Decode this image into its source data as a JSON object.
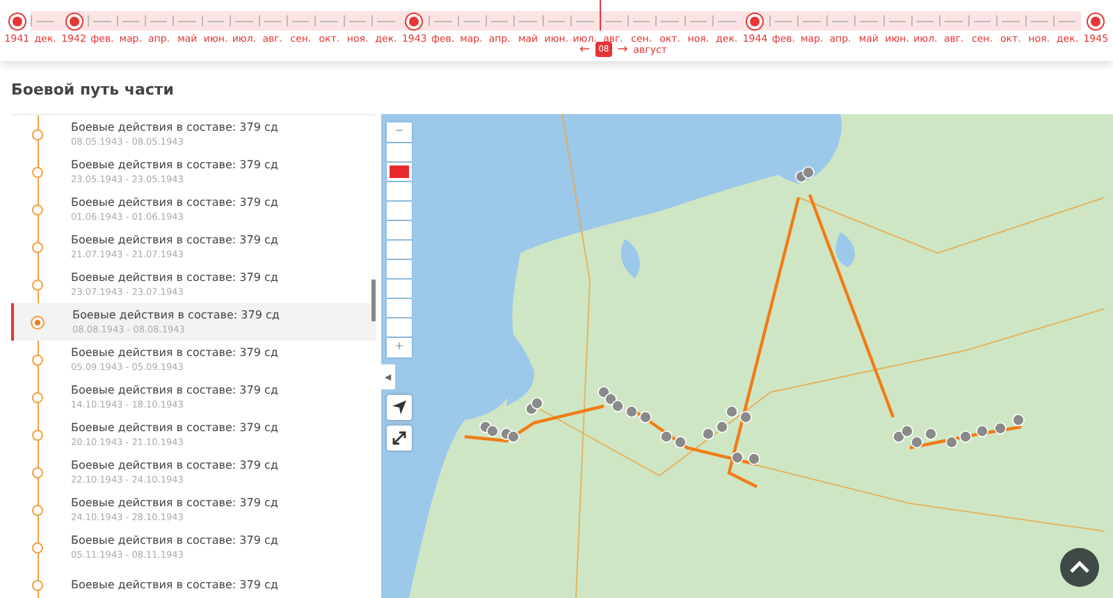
{
  "timeline": {
    "items": [
      {
        "text": "1941",
        "kind": "year",
        "in_range": false,
        "selected": false
      },
      {
        "text": "дек.",
        "kind": "month",
        "in_range": true,
        "selected": false
      },
      {
        "text": "1942",
        "kind": "year",
        "in_range": true,
        "selected": false
      },
      {
        "text": "фев.",
        "kind": "month",
        "in_range": true,
        "selected": false
      },
      {
        "text": "мар.",
        "kind": "month",
        "in_range": true,
        "selected": false
      },
      {
        "text": "апр.",
        "kind": "month",
        "in_range": true,
        "selected": false
      },
      {
        "text": "май",
        "kind": "month",
        "in_range": true,
        "selected": false
      },
      {
        "text": "июн.",
        "kind": "month",
        "in_range": true,
        "selected": false
      },
      {
        "text": "июл.",
        "kind": "month",
        "in_range": true,
        "selected": false
      },
      {
        "text": "авг.",
        "kind": "month",
        "in_range": true,
        "selected": false
      },
      {
        "text": "сен.",
        "kind": "month",
        "in_range": true,
        "selected": false
      },
      {
        "text": "окт.",
        "kind": "month",
        "in_range": true,
        "selected": false
      },
      {
        "text": "ноя.",
        "kind": "month",
        "in_range": true,
        "selected": false
      },
      {
        "text": "дек.",
        "kind": "month",
        "in_range": true,
        "selected": false
      },
      {
        "text": "1943",
        "kind": "year",
        "in_range": true,
        "selected": false
      },
      {
        "text": "фев.",
        "kind": "month",
        "in_range": true,
        "selected": false
      },
      {
        "text": "мар.",
        "kind": "month",
        "in_range": true,
        "selected": false
      },
      {
        "text": "апр.",
        "kind": "month",
        "in_range": true,
        "selected": false
      },
      {
        "text": "май",
        "kind": "month",
        "in_range": true,
        "selected": false
      },
      {
        "text": "июн.",
        "kind": "month",
        "in_range": true,
        "selected": false
      },
      {
        "text": "июл.",
        "kind": "month",
        "in_range": true,
        "selected": false
      },
      {
        "text": "авг.",
        "kind": "month",
        "in_range": true,
        "selected": true
      },
      {
        "text": "сен.",
        "kind": "month",
        "in_range": true,
        "selected": false
      },
      {
        "text": "окт.",
        "kind": "month",
        "in_range": true,
        "selected": false
      },
      {
        "text": "ноя.",
        "kind": "month",
        "in_range": true,
        "selected": false
      },
      {
        "text": "дек.",
        "kind": "month",
        "in_range": true,
        "selected": false
      },
      {
        "text": "1944",
        "kind": "year",
        "in_range": true,
        "selected": false
      },
      {
        "text": "фев.",
        "kind": "month",
        "in_range": true,
        "selected": false
      },
      {
        "text": "мар.",
        "kind": "month",
        "in_range": true,
        "selected": false
      },
      {
        "text": "апр.",
        "kind": "month",
        "in_range": true,
        "selected": false
      },
      {
        "text": "май",
        "kind": "month",
        "in_range": true,
        "selected": false
      },
      {
        "text": "июн.",
        "kind": "month",
        "in_range": true,
        "selected": false
      },
      {
        "text": "июл.",
        "kind": "month",
        "in_range": true,
        "selected": false
      },
      {
        "text": "авг.",
        "kind": "month",
        "in_range": true,
        "selected": false
      },
      {
        "text": "сен.",
        "kind": "month",
        "in_range": true,
        "selected": false
      },
      {
        "text": "окт.",
        "kind": "month",
        "in_range": true,
        "selected": false
      },
      {
        "text": "ноя.",
        "kind": "month",
        "in_range": true,
        "selected": false
      },
      {
        "text": "дек.",
        "kind": "month",
        "in_range": true,
        "selected": false
      },
      {
        "text": "1945",
        "kind": "year",
        "in_range": false,
        "selected": false
      }
    ],
    "marker": {
      "badge": "08",
      "prev": "←",
      "next": "→",
      "month": "август"
    }
  },
  "section_title": "Боевой путь части",
  "events": [
    {
      "title": "Боевые действия в составе: 379 сд",
      "dates": "08.05.1943 - 08.05.1943",
      "selected": false
    },
    {
      "title": "Боевые действия в составе: 379 сд",
      "dates": "23.05.1943 - 23.05.1943",
      "selected": false
    },
    {
      "title": "Боевые действия в составе: 379 сд",
      "dates": "01.06.1943 - 01.06.1943",
      "selected": false
    },
    {
      "title": "Боевые действия в составе: 379 сд",
      "dates": "21.07.1943 - 21.07.1943",
      "selected": false
    },
    {
      "title": "Боевые действия в составе: 379 сд",
      "dates": "23.07.1943 - 23.07.1943",
      "selected": false
    },
    {
      "title": "Боевые действия в составе: 379 сд",
      "dates": "08.08.1943 - 08.08.1943",
      "selected": true
    },
    {
      "title": "Боевые действия в составе: 379 сд",
      "dates": "05.09.1943 - 05.09.1943",
      "selected": false
    },
    {
      "title": "Боевые действия в составе: 379 сд",
      "dates": "14.10.1943 - 18.10.1943",
      "selected": false
    },
    {
      "title": "Боевые действия в составе: 379 сд",
      "dates": "20.10.1943 - 21.10.1943",
      "selected": false
    },
    {
      "title": "Боевые действия в составе: 379 сд",
      "dates": "22.10.1943 - 24.10.1943",
      "selected": false
    },
    {
      "title": "Боевые действия в составе: 379 сд",
      "dates": "24.10.1943 - 28.10.1943",
      "selected": false
    },
    {
      "title": "Боевые действия в составе: 379 сд",
      "dates": "05.11.1943 - 08.11.1943",
      "selected": false
    },
    {
      "title": "Боевые действия в составе: 379 сд",
      "selected": false
    }
  ],
  "map": {
    "zoom_minus": "−",
    "zoom_plus": "+",
    "zoom_steps": [
      {
        "selected": false
      },
      {
        "selected": true
      },
      {
        "selected": false
      },
      {
        "selected": false
      },
      {
        "selected": false
      },
      {
        "selected": false
      },
      {
        "selected": false
      },
      {
        "selected": false
      },
      {
        "selected": false
      },
      {
        "selected": false
      }
    ],
    "collapse": "◀"
  }
}
